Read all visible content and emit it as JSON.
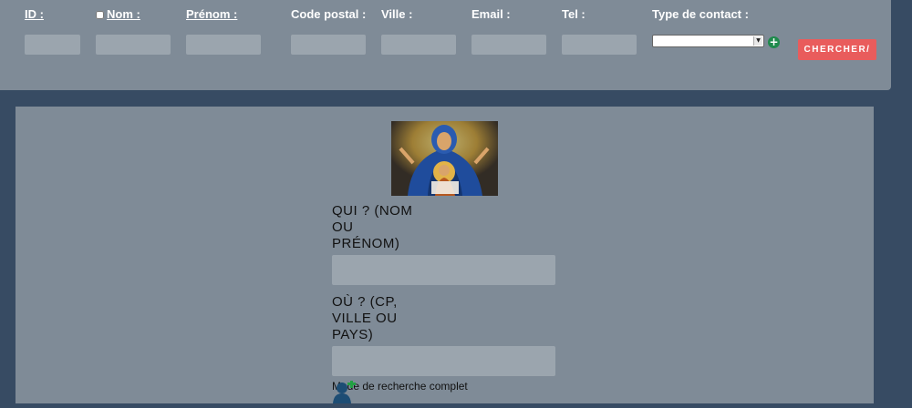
{
  "search_bar": {
    "fields": {
      "id": {
        "label": "ID :"
      },
      "nom": {
        "label": "Nom :",
        "checked": false
      },
      "prenom": {
        "label": "Prénom :"
      },
      "code_postal": {
        "label": "Code postal :"
      },
      "ville": {
        "label": "Ville :"
      },
      "email": {
        "label": "Email :"
      },
      "tel": {
        "label": "Tel :"
      }
    },
    "type_contact": {
      "label": "Type de contact :",
      "selected": ""
    },
    "add_icon": "plus-circle-icon",
    "search_label": "Chercher/"
  },
  "main": {
    "qui_label": "QUI ? (NOM OU PRÉNOM)",
    "qui_value": "",
    "ou_label": "OÙ ? (CP, VILLE OU PAYS)",
    "ou_value": "",
    "mode_label": "Mode de recherche complet",
    "mode_icon": "add-user-icon"
  },
  "colors": {
    "page_bg": "#374b63",
    "panel_bg": "#7f8b97",
    "input_bg": "#9ba5ae",
    "search_button": "#e95c5c",
    "add_green": "#1f8a4c"
  }
}
